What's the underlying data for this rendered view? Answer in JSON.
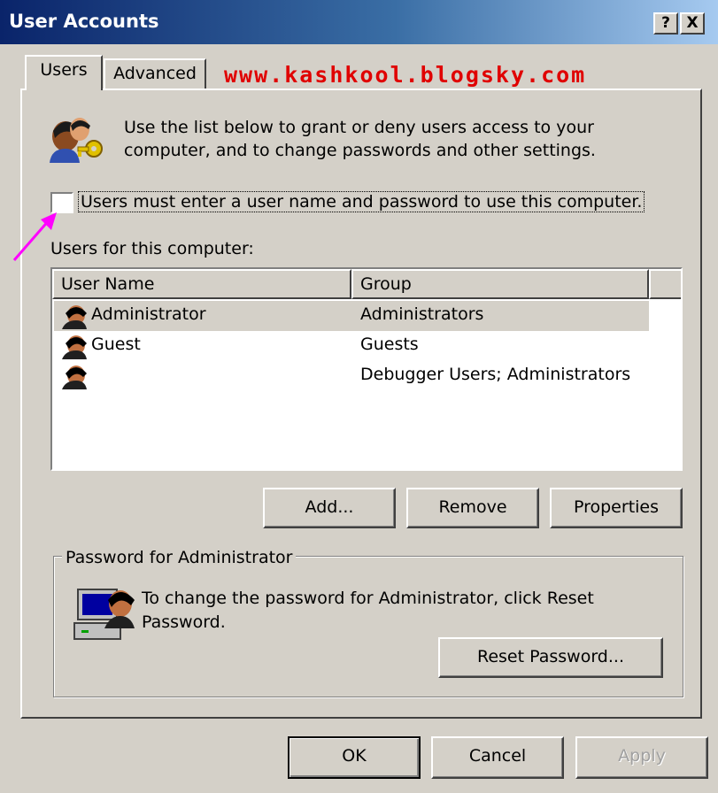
{
  "window": {
    "title": "User Accounts",
    "help_button": "?",
    "close_button": "X"
  },
  "tabs": [
    {
      "label": "Users",
      "active": true
    },
    {
      "label": "Advanced",
      "active": false
    }
  ],
  "watermark": "www.kashkool.blogsky.com",
  "intro": {
    "line1": "Use the list below to grant or deny users access to your",
    "line2": "computer, and to change passwords and other settings."
  },
  "require_login": {
    "label": "Users must enter a user name and password to use this computer.",
    "checked": false
  },
  "users_list": {
    "caption": "Users for this computer:",
    "columns": [
      "User Name",
      "Group"
    ],
    "rows": [
      {
        "name": "Administrator",
        "group": "Administrators",
        "selected": true
      },
      {
        "name": "Guest",
        "group": "Guests",
        "selected": false
      },
      {
        "name": "",
        "group": "Debugger Users; Administrators",
        "selected": false
      }
    ]
  },
  "list_buttons": {
    "add": "Add...",
    "remove": "Remove",
    "properties": "Properties"
  },
  "password_group": {
    "title": "Password for Administrator",
    "text_line1": "To change the password for Administrator, click Reset",
    "text_line2": "Password.",
    "reset_button": "Reset Password..."
  },
  "dialog_buttons": {
    "ok": "OK",
    "cancel": "Cancel",
    "apply": "Apply"
  },
  "colors": {
    "titlebar_start": "#0a246a",
    "titlebar_end": "#a6caf0",
    "face": "#d4d0c8",
    "watermark": "#e00000",
    "arrow": "#ff00ff"
  }
}
